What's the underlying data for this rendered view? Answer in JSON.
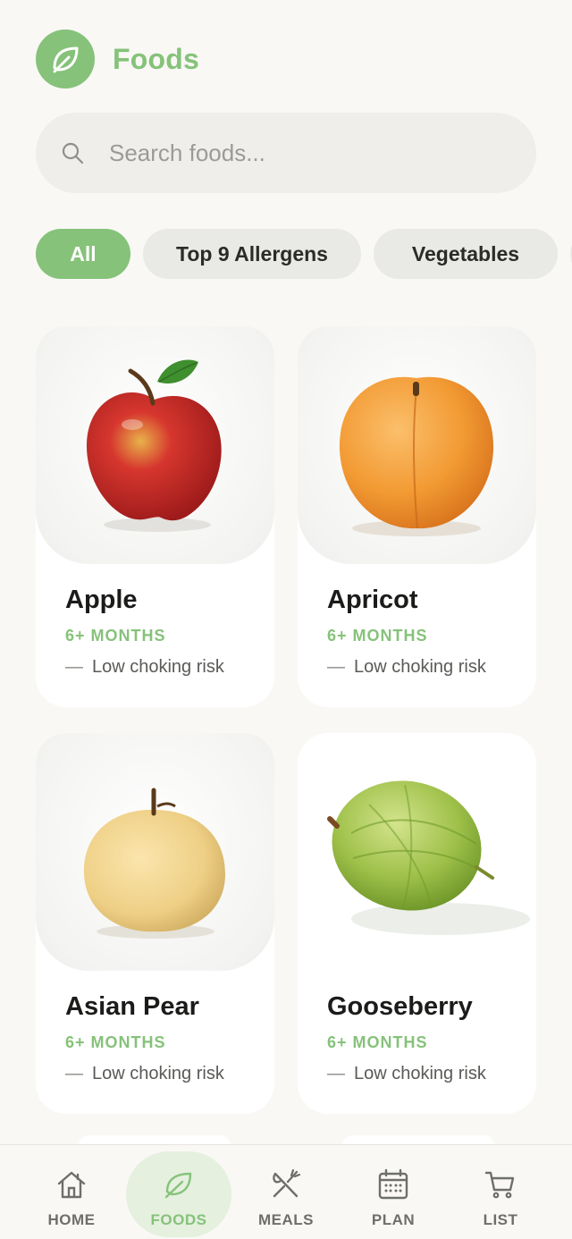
{
  "app": {
    "title": "Foods",
    "logo_icon": "leaf-icon",
    "accent": "#86c27a"
  },
  "search": {
    "placeholder": "Search foods...",
    "value": ""
  },
  "filters": [
    {
      "label": "All",
      "active": true
    },
    {
      "label": "Top 9 Allergens",
      "active": false
    },
    {
      "label": "Vegetables",
      "active": false
    }
  ],
  "foods": [
    {
      "name": "Apple",
      "age": "6+ MONTHS",
      "risk": "Low choking risk",
      "dash": "—"
    },
    {
      "name": "Apricot",
      "age": "6+ MONTHS",
      "risk": "Low choking risk",
      "dash": "—"
    },
    {
      "name": "Asian Pear",
      "age": "6+ MONTHS",
      "risk": "Low choking risk",
      "dash": "—"
    },
    {
      "name": "Gooseberry",
      "age": "6+ MONTHS",
      "risk": "Low choking risk",
      "dash": "—"
    }
  ],
  "nav": [
    {
      "label": "HOME",
      "icon": "home-icon",
      "active": false
    },
    {
      "label": "FOODS",
      "icon": "leaf-icon",
      "active": true
    },
    {
      "label": "MEALS",
      "icon": "fork-knife-icon",
      "active": false
    },
    {
      "label": "PLAN",
      "icon": "calendar-icon",
      "active": false
    },
    {
      "label": "LIST",
      "icon": "cart-icon",
      "active": false
    }
  ]
}
